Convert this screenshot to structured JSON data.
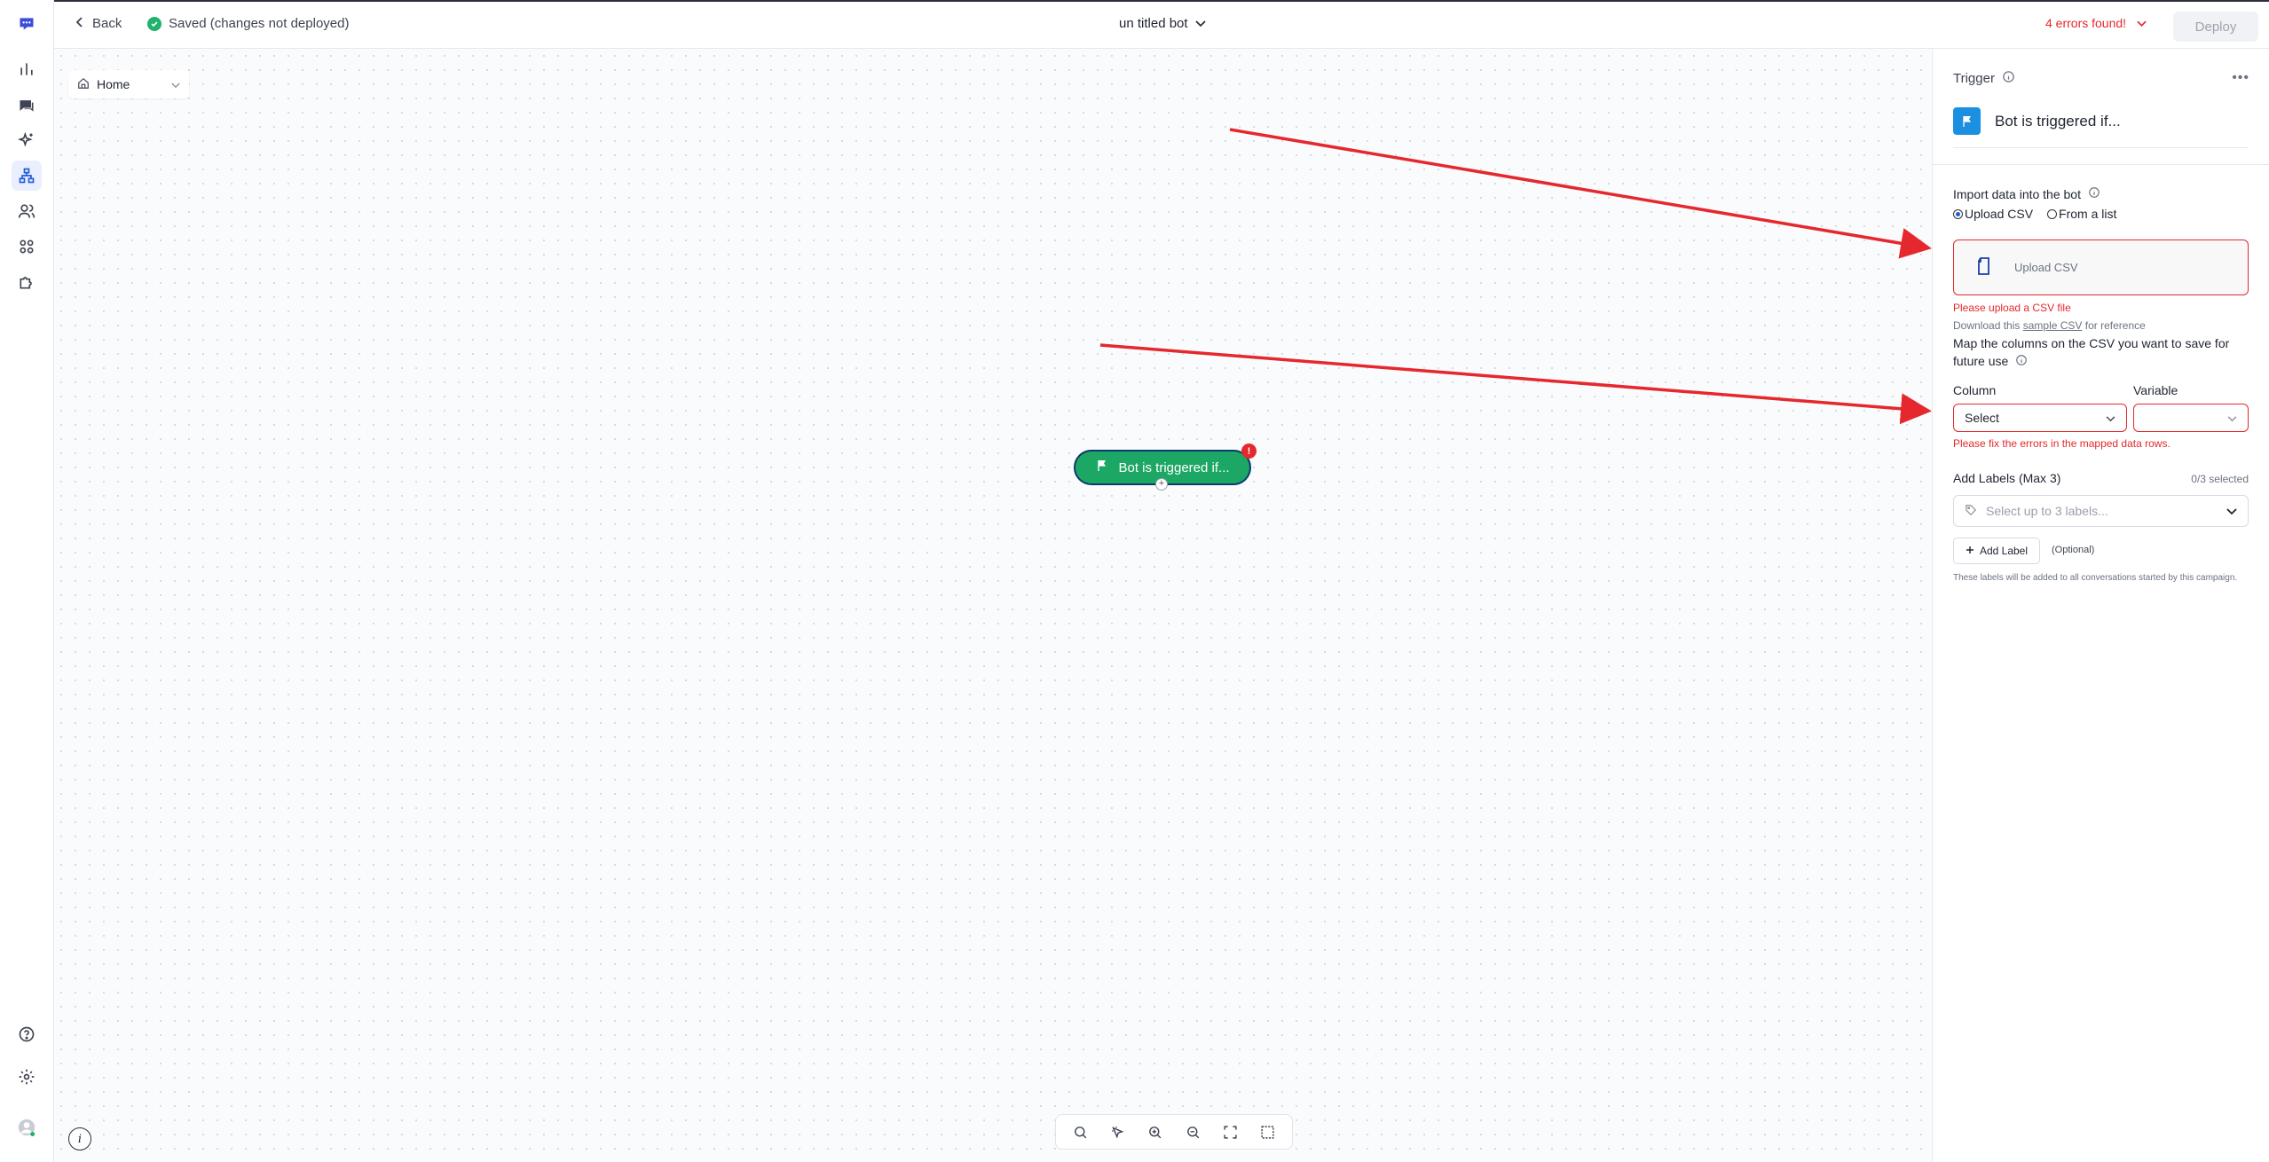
{
  "topbar": {
    "back_label": "Back",
    "saved_status": "Saved (changes not deployed)",
    "bot_name": "un titled bot",
    "errors_text": "4 errors found!",
    "deploy_label": "Deploy"
  },
  "canvas": {
    "home_select": "Home",
    "node_label": "Bot is triggered if...",
    "node_error_badge": "!",
    "node_add": "+",
    "info_button": "i"
  },
  "panel": {
    "header": "Trigger",
    "trigger_title": "Bot is triggered if...",
    "import_label": "Import data into the bot",
    "radio_upload": "Upload CSV",
    "radio_list": "From a list",
    "upload_label": "Upload CSV",
    "upload_error": "Please upload a CSV file",
    "download_prefix": "Download this",
    "download_link": "sample CSV",
    "download_suffix": "for reference",
    "map_text": "Map the columns on the CSV you want to save for future use",
    "column_label": "Column",
    "variable_label": "Variable",
    "column_select": "Select",
    "variable_select": "",
    "mapping_error": "Please fix the errors in the mapped data rows.",
    "labels_title": "Add Labels (Max 3)",
    "labels_count": "0/3 selected",
    "labels_placeholder": "Select up to 3 labels...",
    "add_label_button": "Add Label",
    "optional": "(Optional)",
    "labels_note": "These labels will be added to all conversations started by this campaign."
  },
  "colors": {
    "accent": "#1f5bd8",
    "error": "#e5282d",
    "success": "#1fb36b",
    "node": "#1da765",
    "trigger_icon": "#1b8fe0"
  },
  "icons": {
    "rail": [
      "logo-icon",
      "analytics-icon",
      "chat-icon",
      "ai-sparkle-icon",
      "flow-icon",
      "contacts-icon",
      "apps-icon",
      "integrations-icon",
      "help-icon",
      "settings-icon",
      "avatar"
    ],
    "toolbar": [
      "search-icon",
      "auto-layout-icon",
      "zoom-in-icon",
      "zoom-out-icon",
      "fit-screen-icon",
      "select-area-icon"
    ]
  }
}
